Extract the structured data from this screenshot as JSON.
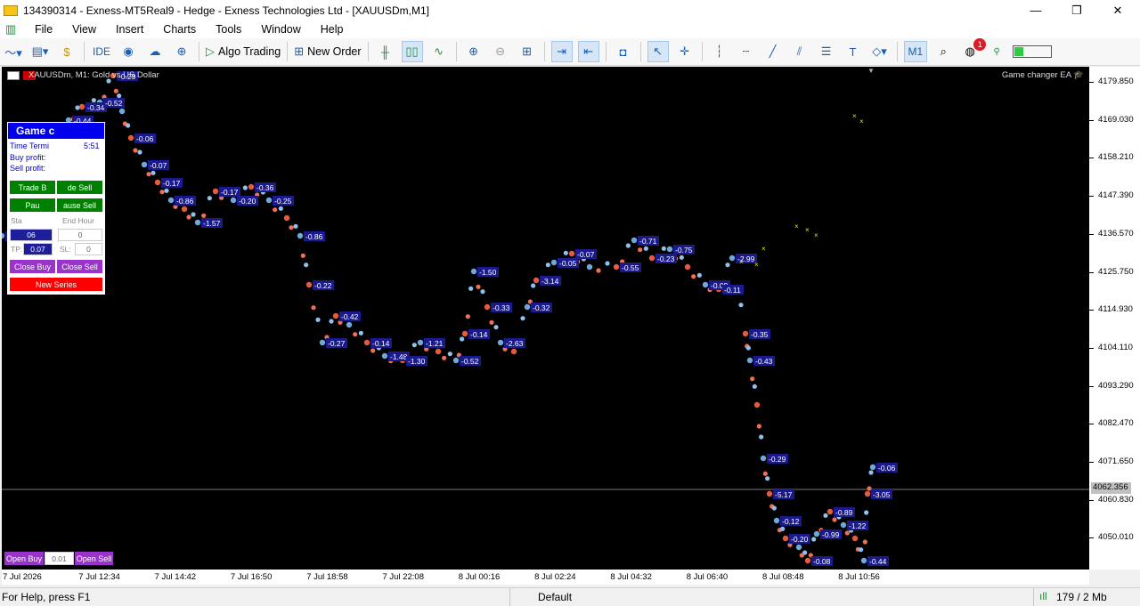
{
  "window": {
    "title": "134390314 - Exness-MT5Real9 - Hedge - Exness Technologies Ltd - [XAUUSDm,M1]",
    "minimize": "—",
    "restore": "❐",
    "close": "✕"
  },
  "menu": [
    "File",
    "View",
    "Insert",
    "Charts",
    "Tools",
    "Window",
    "Help"
  ],
  "toolbar": {
    "ide": "IDE",
    "algo_trading": "Algo Trading",
    "new_order": "New Order",
    "timeframe": "M1",
    "notification_count": "1"
  },
  "chart": {
    "title": "XAUUSDm, M1:  Gold vs US Dollar",
    "ea_name": "Game changer EA",
    "current_price": "4062.356",
    "price_labels": [
      "4179.850",
      "4169.030",
      "4158.210",
      "4147.390",
      "4136.570",
      "4125.750",
      "4114.930",
      "4104.110",
      "4093.290",
      "4082.470",
      "4071.650",
      "4060.830",
      "4050.010"
    ],
    "time_labels": [
      "7 Jul 2026",
      "7 Jul 12:34",
      "7 Jul 14:42",
      "7 Jul 16:50",
      "7 Jul 18:58",
      "7 Jul 22:08",
      "8 Jul 00:16",
      "8 Jul 02:24",
      "8 Jul 04:32",
      "8 Jul 06:40",
      "8 Jul 08:48",
      "8 Jul 10:56"
    ],
    "trade_labels": [
      "-0.61",
      "-0.52",
      "-0.02",
      "-0.44",
      "-0.34",
      "-0.52",
      "-0.29",
      "-0.06",
      "-0.07",
      "-0.17",
      "-0.86",
      "-1.57",
      "-0.17",
      "-0.20",
      "-0.36",
      "-0.25",
      "-0.86",
      "-0.22",
      "-0.27",
      "-0.42",
      "-0.14",
      "-1.48",
      "-1.30",
      "-1.21",
      "-0.52",
      "-0.14",
      "-1.50",
      "-0.33",
      "-2.63",
      "-0.32",
      "-3.14",
      "-0.05",
      "-0.07",
      "-0.55",
      "-0.71",
      "-0.23",
      "-0.75",
      "-0.09",
      "-0.11",
      "-2.99",
      "-0.35",
      "-0.43",
      "-0.29",
      "-5.17",
      "-0.12",
      "-0.20",
      "-0.08",
      "-0.99",
      "-0.89",
      "-1.22",
      "-0.44",
      "-3.05",
      "-0.06"
    ]
  },
  "panel": {
    "header": "Game c",
    "time_label": "Time Termi",
    "time_value": "5:51",
    "buy_profit": "Buy profit:",
    "sell_profit": "Sell profit:",
    "trade_buy": "Trade B",
    "trade_sell": "de Sell",
    "pause_buy": "Pau",
    "pause_sell": "ause Sell",
    "start_label": "Sta",
    "end_hour_label": "End Hour",
    "start_value": "06",
    "end_value": "0",
    "tp_label": "TP:",
    "tp_value": "0.07",
    "sl_label": "SL:",
    "sl_value": "0",
    "close_buy": "Close Buy",
    "close_sell": "Close Sell",
    "new_series": "New Series",
    "open_buy": "Open Buy",
    "lot_value": "0.01",
    "open_sell": "Open Sell"
  },
  "status": {
    "help": "For Help, press F1",
    "profile": "Default",
    "traffic": "179 / 2 Mb"
  }
}
